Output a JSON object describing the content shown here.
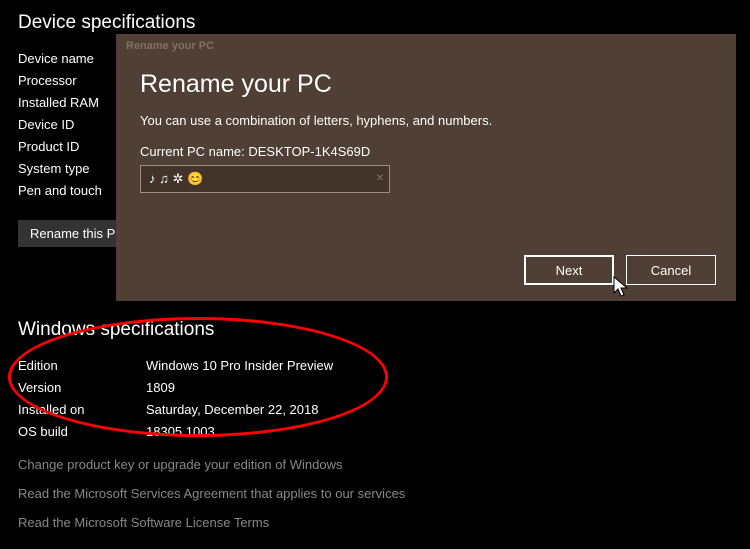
{
  "device_section": {
    "title": "Device specifications",
    "labels": {
      "device_name": "Device name",
      "processor": "Processor",
      "installed_ram": "Installed RAM",
      "device_id": "Device ID",
      "product_id": "Product ID",
      "system_type": "System type",
      "pen_touch": "Pen and touch"
    },
    "rename_button": "Rename this PC"
  },
  "windows_section": {
    "title": "Windows specifications",
    "rows": {
      "edition_label": "Edition",
      "edition_value": "Windows 10 Pro Insider Preview",
      "version_label": "Version",
      "version_value": "1809",
      "installed_label": "Installed on",
      "installed_value": "Saturday, December 22, 2018",
      "build_label": "OS build",
      "build_value": "18305.1003"
    },
    "links": {
      "product_key": "Change product key or upgrade your edition of Windows",
      "services": "Read the Microsoft Services Agreement that applies to our services",
      "license": "Read the Microsoft Software License Terms"
    }
  },
  "modal": {
    "titlebar": "Rename your PC",
    "heading": "Rename your PC",
    "desc": "You can use a combination of letters, hyphens, and numbers.",
    "current_label": "Current PC name: ",
    "current_name": "DESKTOP-1K4S69D",
    "input_value": "♪ ♫ ✲ 😊",
    "clear_icon": "×",
    "next_button": "Next",
    "cancel_button": "Cancel"
  }
}
